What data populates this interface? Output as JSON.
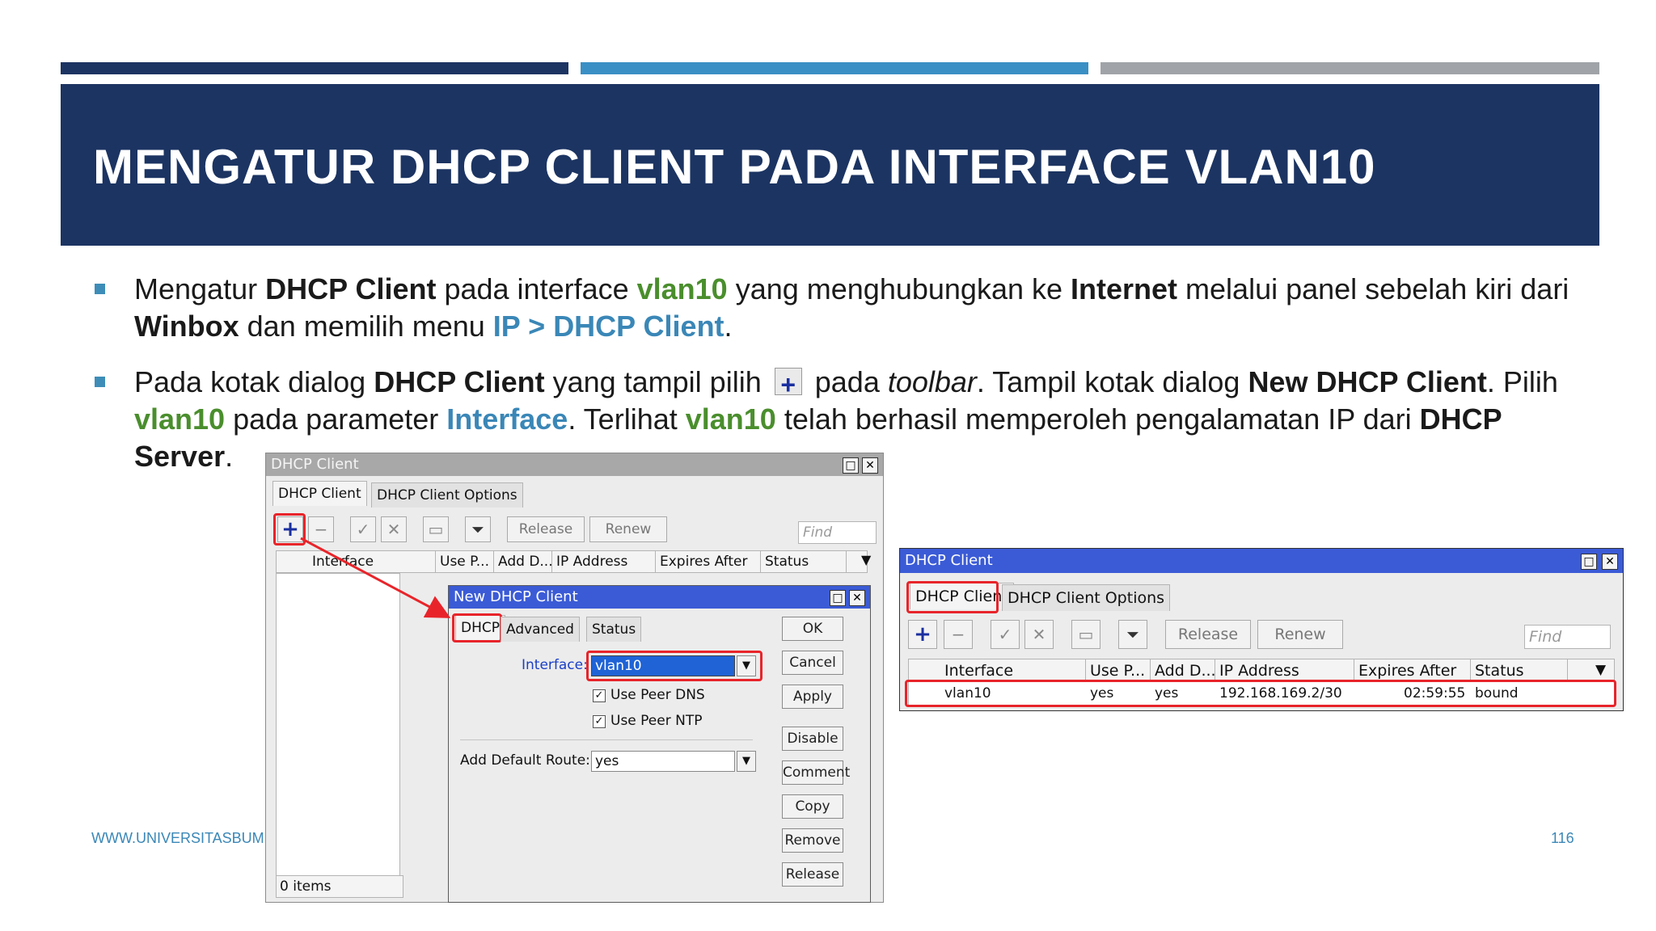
{
  "slide": {
    "title": "MENGATUR DHCP CLIENT PADA INTERFACE VLAN10",
    "footer_url": "WWW.UNIVERSITASBUMIGORA.AC.ID",
    "page_number": "116",
    "colors": {
      "banner": "#1c3462",
      "bar_dark": "#1c3462",
      "bar_mid": "#3a8fc4",
      "bar_light": "#a0a4a8",
      "accent_green": "#4a8e2d",
      "accent_blue": "#3a87b7",
      "highlight_red": "#e8242a"
    }
  },
  "bullet1": {
    "t1": "Mengatur ",
    "b1": "DHCP Client",
    "t2": " pada interface ",
    "g1": "vlan10",
    "t3": " yang menghubungkan ke ",
    "b2": "Internet",
    "t4": " melalui panel sebelah kiri dari",
    "b3": "Winbox",
    "t5": " dan memilih menu ",
    "u1": "IP > DHCP Client",
    "t6": "."
  },
  "bullet2": {
    "t1": "Pada kotak dialog ",
    "b1": "DHCP Client",
    "t2": " yang tampil pilih",
    "t3": "pada ",
    "i1": "toolbar",
    "t4": ".  Tampil kotak dialog ",
    "b2": "New DHCP Client",
    "t5": ". Pilih",
    "g1": "vlan10",
    "t6": " pada parameter ",
    "u1": "Interface",
    "t7": ". Terlihat ",
    "g2": "vlan10",
    "t8": " telah berhasil memperoleh pengalamatan IP dari ",
    "b3": "DHCP",
    "b4": "Server",
    "t9": "."
  },
  "left_window": {
    "title": "DHCP Client",
    "tabs": [
      "DHCP Client",
      "DHCP Client Options"
    ],
    "buttons": {
      "release": "Release",
      "renew": "Renew"
    },
    "find_placeholder": "Find",
    "columns": [
      "Interface",
      "Use P...",
      "Add D...",
      "IP Address",
      "Expires After",
      "Status"
    ],
    "status_bar": "0 items"
  },
  "new_dialog": {
    "title": "New DHCP Client",
    "tabs": [
      "DHCP",
      "Advanced",
      "Status"
    ],
    "interface_label": "Interface:",
    "interface_value": "vlan10",
    "use_peer_dns": "Use Peer DNS",
    "use_peer_ntp": "Use Peer NTP",
    "add_default_route_label": "Add Default Route:",
    "add_default_route_value": "yes",
    "buttons": [
      "OK",
      "Cancel",
      "Apply",
      "Disable",
      "Comment",
      "Copy",
      "Remove",
      "Release"
    ]
  },
  "right_window": {
    "title": "DHCP Client",
    "tabs": [
      "DHCP Client",
      "DHCP Client Options"
    ],
    "buttons": {
      "release": "Release",
      "renew": "Renew"
    },
    "find_placeholder": "Find",
    "columns": [
      "Interface",
      "Use P...",
      "Add D...",
      "IP Address",
      "Expires After",
      "Status"
    ],
    "row": {
      "interface": "vlan10",
      "use_peer": "yes",
      "add_default": "yes",
      "ip_address": "192.168.169.2/30",
      "expires_after": "02:59:55",
      "status": "bound"
    }
  }
}
